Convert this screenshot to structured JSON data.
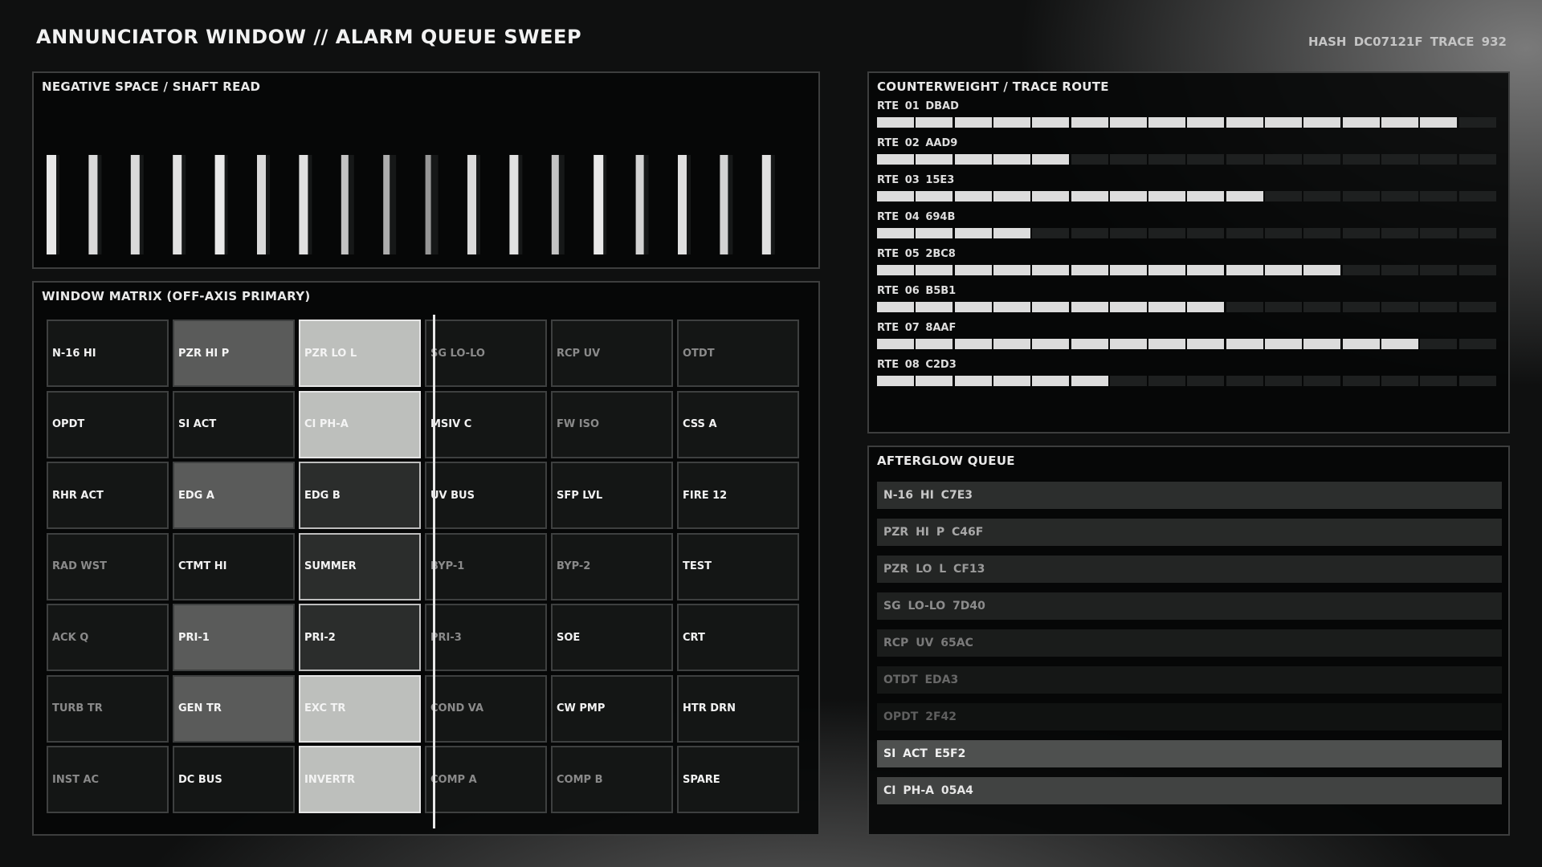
{
  "header": {
    "title": "ANNUNCIATOR WINDOW  //  ALARM QUEUE SWEEP",
    "hash": "HASH DC07121F  TRACE 932"
  },
  "shaft_panel": {
    "title": "NEGATIVE SPACE  /  SHAFT READ",
    "bars": [
      0.95,
      0.85,
      0.85,
      0.9,
      0.95,
      0.85,
      0.9,
      0.7,
      0.55,
      0.4,
      0.85,
      0.9,
      0.7,
      0.95,
      0.8,
      0.9,
      0.8,
      0.9
    ]
  },
  "matrix": {
    "title": "WINDOW MATRIX  (OFF-AXIS PRIMARY)",
    "rows": [
      [
        {
          "label": "N-16 HI",
          "state": 0
        },
        {
          "label": "PZR HI P",
          "state": 2
        },
        {
          "label": "PZR LO L",
          "state": 3
        },
        {
          "label": "SG LO-LO",
          "state": 1
        },
        {
          "label": "RCP UV",
          "state": 1
        },
        {
          "label": "OTDT",
          "state": 1
        }
      ],
      [
        {
          "label": "OPDT",
          "state": 0
        },
        {
          "label": "SI ACT",
          "state": 0
        },
        {
          "label": "CI PH-A",
          "state": 3
        },
        {
          "label": "MSIV C",
          "state": 0
        },
        {
          "label": "FW ISO",
          "state": 1
        },
        {
          "label": "CSS A",
          "state": 0
        }
      ],
      [
        {
          "label": "RHR ACT",
          "state": 0
        },
        {
          "label": "EDG A",
          "state": 2
        },
        {
          "label": "EDG B",
          "state": 4
        },
        {
          "label": "UV BUS",
          "state": 0
        },
        {
          "label": "SFP LVL",
          "state": 0
        },
        {
          "label": "FIRE 12",
          "state": 0
        }
      ],
      [
        {
          "label": "RAD WST",
          "state": 1
        },
        {
          "label": "CTMT HI",
          "state": 0
        },
        {
          "label": "SUMMER",
          "state": 4
        },
        {
          "label": "BYP-1",
          "state": 1
        },
        {
          "label": "BYP-2",
          "state": 1
        },
        {
          "label": "TEST",
          "state": 0
        }
      ],
      [
        {
          "label": "ACK Q",
          "state": 1
        },
        {
          "label": "PRI-1",
          "state": 2
        },
        {
          "label": "PRI-2",
          "state": 4
        },
        {
          "label": "PRI-3",
          "state": 1
        },
        {
          "label": "SOE",
          "state": 0
        },
        {
          "label": "CRT",
          "state": 0
        }
      ],
      [
        {
          "label": "TURB TR",
          "state": 1
        },
        {
          "label": "GEN TR",
          "state": 2
        },
        {
          "label": "EXC TR",
          "state": 3
        },
        {
          "label": "COND VA",
          "state": 1
        },
        {
          "label": "CW PMP",
          "state": 0
        },
        {
          "label": "HTR DRN",
          "state": 0
        }
      ],
      [
        {
          "label": "INST AC",
          "state": 1
        },
        {
          "label": "DC BUS",
          "state": 0
        },
        {
          "label": "INVERTR",
          "state": 3
        },
        {
          "label": "COMP A",
          "state": 1
        },
        {
          "label": "COMP B",
          "state": 1
        },
        {
          "label": "SPARE",
          "state": 0
        }
      ]
    ]
  },
  "trace": {
    "title": "COUNTERWEIGHT  /  TRACE ROUTE",
    "total_segments": 16,
    "routes": [
      {
        "label": "RTE 01  DBAD",
        "filled": 15
      },
      {
        "label": "RTE 02  AAD9",
        "filled": 5
      },
      {
        "label": "RTE 03  15E3",
        "filled": 10
      },
      {
        "label": "RTE 04  694B",
        "filled": 4
      },
      {
        "label": "RTE 05  2BC8",
        "filled": 12
      },
      {
        "label": "RTE 06  B5B1",
        "filled": 9
      },
      {
        "label": "RTE 07  8AAF",
        "filled": 14
      },
      {
        "label": "RTE 08  C2D3",
        "filled": 6
      }
    ]
  },
  "queue": {
    "title": "AFTERGLOW QUEUE",
    "items": [
      {
        "label": "N-16 HI  C7E3",
        "bg": "#2c2e2d",
        "color": "#c8c8c8"
      },
      {
        "label": "PZR HI P  C46F",
        "bg": "#272928",
        "color": "#a8a8a8"
      },
      {
        "label": "PZR LO L  CF13",
        "bg": "#232524",
        "color": "#9a9a9a"
      },
      {
        "label": "SG LO-LO  7D40",
        "bg": "#1f2120",
        "color": "#8c8c8c"
      },
      {
        "label": "RCP UV  65AC",
        "bg": "#1a1c1b",
        "color": "#7a7a7a"
      },
      {
        "label": "OTDT  EDA3",
        "bg": "#151716",
        "color": "#686868"
      },
      {
        "label": "OPDT  2F42",
        "bg": "#101211",
        "color": "#5e5e5e"
      },
      {
        "label": "SI ACT  E5F2",
        "bg": "#4e504f",
        "color": "#f0f0f0"
      },
      {
        "label": "CI PH-A  05A4",
        "bg": "#414342",
        "color": "#e6e6e6"
      }
    ]
  }
}
